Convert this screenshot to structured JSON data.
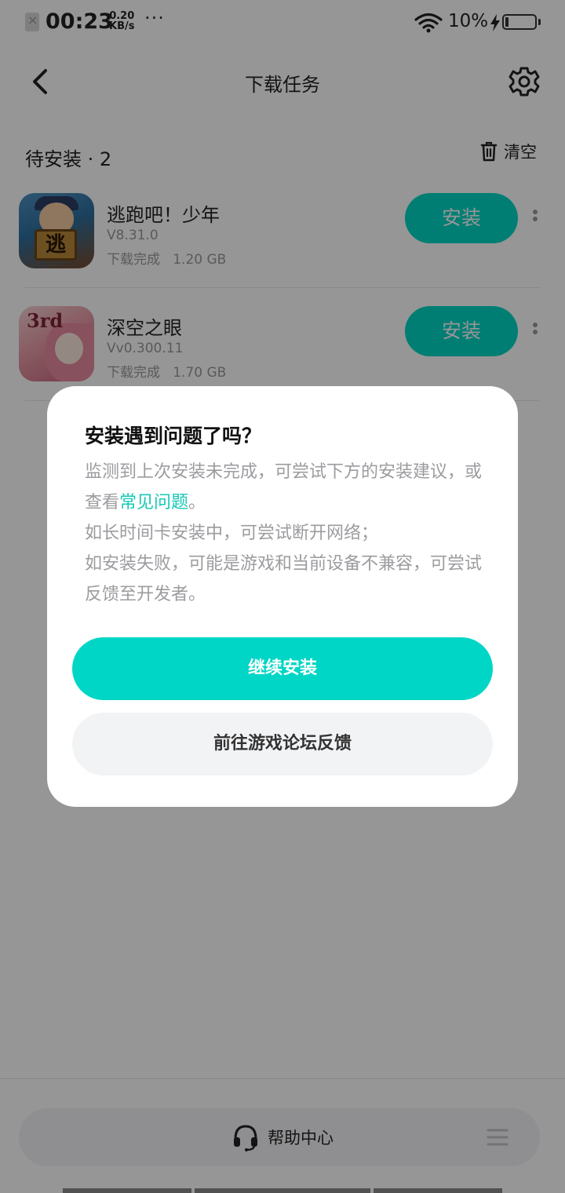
{
  "status_bar": {
    "time": "00:23",
    "net_speed_value": "0.20",
    "net_speed_unit": "KB/s",
    "dots": "···",
    "battery_percent": "10%",
    "battery_level": 0.1,
    "icons": [
      "sim-off-icon",
      "wifi-icon",
      "charging-icon",
      "battery-icon"
    ]
  },
  "header": {
    "title": "下载任务",
    "back_icon": "chevron-left-icon",
    "settings_icon": "gear-icon"
  },
  "section": {
    "title": "待安装 · 2",
    "clear_label": "清空"
  },
  "downloads": [
    {
      "name": "逃跑吧！少年",
      "version": "V8.31.0",
      "status": "下载完成",
      "size": "1.20 GB",
      "button": "安装",
      "icon_text": "逃"
    },
    {
      "name": "深空之眼",
      "version": "Vv0.300.11",
      "status": "下载完成",
      "size": "1.70 GB",
      "button": "安装",
      "icon_text": "3rd"
    }
  ],
  "bottom_bar": {
    "help_label": "帮助中心",
    "help_icon": "headset-icon",
    "menu_icon": "menu-icon"
  },
  "dialog": {
    "title": "安装遇到问题了吗？",
    "body_pre": "监测到上次安装未完成，可尝试下方的安装建议，或查看",
    "faq_link": "常见问题",
    "body_post": "。",
    "line2": "如长时间卡安装中，可尝试断开网络；",
    "line3": "如安装失败，可能是游戏和当前设备不兼容，可尝试反馈至开发者。",
    "continue_label": "继续安装",
    "forum_label": "前往游戏论坛反馈"
  },
  "colors": {
    "accent": "#00d6c6",
    "link": "#16c8b7",
    "overlay": "rgba(0,0,0,0.41)"
  }
}
